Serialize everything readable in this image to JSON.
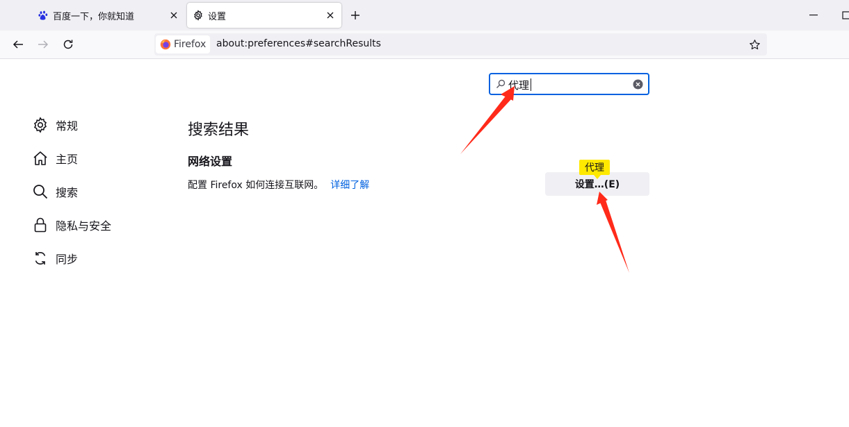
{
  "tabs": [
    {
      "label": "百度一下，你就知道",
      "icon": "baidu-paw-icon"
    },
    {
      "label": "设置",
      "icon": "gear-icon"
    }
  ],
  "navbar": {
    "identity_label": "Firefox",
    "url": "about:preferences#searchResults"
  },
  "search": {
    "value": "代理"
  },
  "categories": [
    {
      "label": "常规",
      "icon": "gear-icon"
    },
    {
      "label": "主页",
      "icon": "home-icon"
    },
    {
      "label": "搜索",
      "icon": "search-icon"
    },
    {
      "label": "隐私与安全",
      "icon": "lock-icon"
    },
    {
      "label": "同步",
      "icon": "sync-icon"
    }
  ],
  "results": {
    "heading": "搜索结果",
    "section_title": "网络设置",
    "description": "配置 Firefox 如何连接互联网。",
    "learn_more": "详细了解",
    "settings_button": "设置…(E)",
    "highlight_label": "代理"
  },
  "colors": {
    "accent": "#0061e0",
    "highlight": "#ffe900",
    "annotation_arrow": "#ff2a1a"
  }
}
